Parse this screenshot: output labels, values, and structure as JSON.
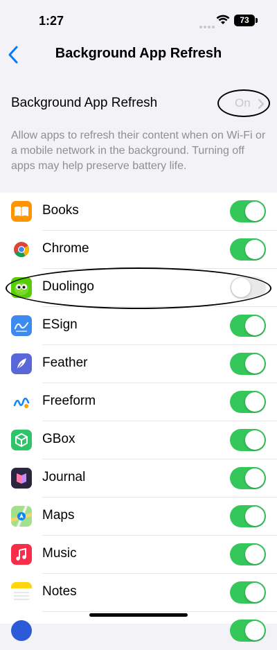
{
  "status_bar": {
    "time": "1:27",
    "battery": "73"
  },
  "nav": {
    "title": "Background App Refresh"
  },
  "master": {
    "label": "Background App Refresh",
    "value": "On"
  },
  "description": "Allow apps to refresh their content when on Wi-Fi or a mobile network in the background. Turning off apps may help preserve battery life.",
  "colors": {
    "toggle_on": "#34c759",
    "accent": "#007aff",
    "background": "#f2f2f7"
  },
  "apps": [
    {
      "name": "Books",
      "icon": "books-icon",
      "enabled": true
    },
    {
      "name": "Chrome",
      "icon": "chrome-icon",
      "enabled": true
    },
    {
      "name": "Duolingo",
      "icon": "duolingo-icon",
      "enabled": false
    },
    {
      "name": "ESign",
      "icon": "esign-icon",
      "enabled": true
    },
    {
      "name": "Feather",
      "icon": "feather-icon",
      "enabled": true
    },
    {
      "name": "Freeform",
      "icon": "freeform-icon",
      "enabled": true
    },
    {
      "name": "GBox",
      "icon": "gbox-icon",
      "enabled": true
    },
    {
      "name": "Journal",
      "icon": "journal-icon",
      "enabled": true
    },
    {
      "name": "Maps",
      "icon": "maps-icon",
      "enabled": true
    },
    {
      "name": "Music",
      "icon": "music-icon",
      "enabled": true
    },
    {
      "name": "Notes",
      "icon": "notes-icon",
      "enabled": true
    }
  ]
}
